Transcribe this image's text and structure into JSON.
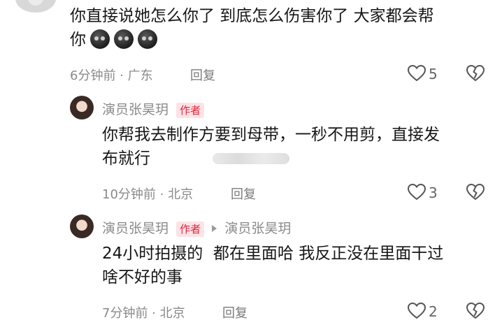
{
  "comments": [
    {
      "text_line1": "你直接说她怎么你了 到底怎么伤害你了 大家都会帮",
      "text_line2": "你",
      "emoji_names": [
        "face-emoji",
        "face-emoji",
        "face-emoji"
      ],
      "time_location": "6分钟前 · 广东",
      "reply_label": "回复",
      "like_count": "5"
    }
  ],
  "replies": [
    {
      "author": "演员张昊玥",
      "badge": "作者",
      "text_line1": "你帮我去制作方要到母带，一秒不用剪，直接发",
      "text_line2": "布就行",
      "time_location": "10分钟前 · 北京",
      "reply_label": "回复",
      "like_count": "3"
    },
    {
      "author": "演员张昊玥",
      "badge": "作者",
      "reply_to": "演员张昊玥",
      "text_line1": "24小时拍摄的  都在里面哈 我反正没在里面干过",
      "text_line2": "啥不好的事",
      "time_location": "7分钟前 · 北京",
      "reply_label": "回复",
      "like_count": "2"
    }
  ],
  "colors": {
    "badge_text": "#e1243c",
    "badge_bg": "#fde3e6",
    "meta_text": "#8a8a8a"
  }
}
